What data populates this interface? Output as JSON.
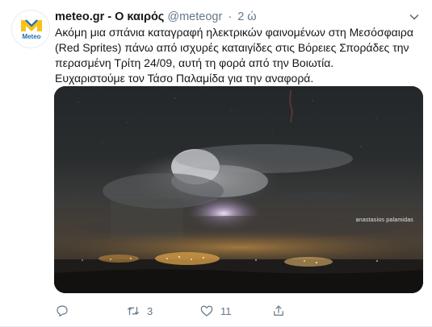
{
  "tweet": {
    "avatar": {
      "label": "Meteo",
      "icon": "meteo-logo"
    },
    "display_name": "meteo.gr - Ο καιρός",
    "handle": "@meteogr",
    "separator": "·",
    "time": "2 ώ",
    "text_lines": [
      "Ακόμη μια σπάνια καταγραφή ηλεκτρικών φαινομένων στη Μεσόσφαιρα",
      "(Red Sprites) πάνω από ισχυρές καταιγίδες στις Βόρειες Σποράδες την",
      "περασμένη Τρίτη 24/09, αυτή τη φορά από την Βοιωτία.",
      "Ευχαριστούμε τον Τάσο Παλαμίδα για την αναφορά."
    ],
    "photo": {
      "watermark": "anastasios palamidas"
    },
    "actions": {
      "reply": {
        "icon": "reply-icon",
        "count": ""
      },
      "retweet": {
        "icon": "retweet-icon",
        "count": "3"
      },
      "like": {
        "icon": "heart-icon",
        "count": "11"
      },
      "share": {
        "icon": "share-icon",
        "count": ""
      }
    },
    "colors": {
      "text": "#14171a",
      "secondary": "#657786",
      "logo_yellow": "#f7c21b",
      "logo_blue": "#1a6fb5"
    }
  }
}
